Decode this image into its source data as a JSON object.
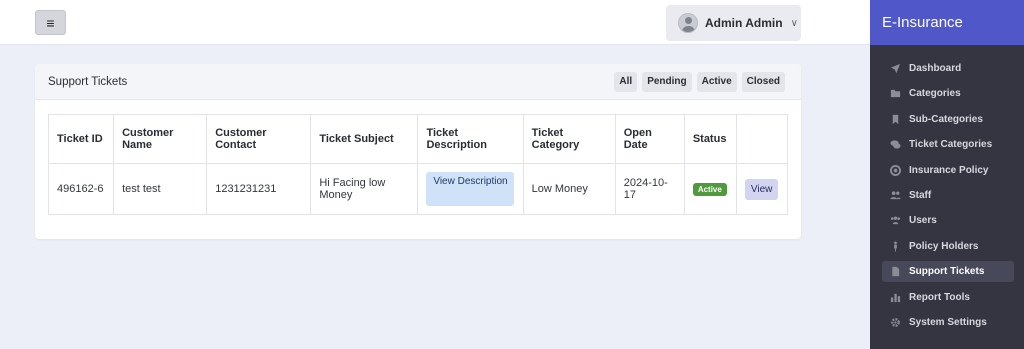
{
  "topbar": {
    "menu_icon": "≡",
    "user_name": "Admin Admin",
    "chevron": "∨"
  },
  "sidebar": {
    "brand": "E-Insurance",
    "items": [
      {
        "label": "Dashboard",
        "icon": "send-icon"
      },
      {
        "label": "Categories",
        "icon": "folder-icon"
      },
      {
        "label": "Sub-Categories",
        "icon": "bookmark-icon"
      },
      {
        "label": "Ticket Categories",
        "icon": "comments-icon"
      },
      {
        "label": "Insurance Policy",
        "icon": "lifebuoy-icon"
      },
      {
        "label": "Staff",
        "icon": "users-icon"
      },
      {
        "label": "Users",
        "icon": "user-group-icon"
      },
      {
        "label": "Policy Holders",
        "icon": "person-icon"
      },
      {
        "label": "Support Tickets",
        "icon": "file-icon",
        "active": true
      },
      {
        "label": "Report Tools",
        "icon": "bar-chart-icon"
      },
      {
        "label": "System Settings",
        "icon": "gear-icon"
      }
    ]
  },
  "card": {
    "title": "Support Tickets",
    "filters": [
      "All",
      "Pending",
      "Active",
      "Closed"
    ]
  },
  "table": {
    "headers": [
      "Ticket ID",
      "Customer Name",
      "Customer Contact",
      "Ticket Subject",
      "Ticket Description",
      "Ticket Category",
      "Open Date",
      "Status",
      ""
    ],
    "rows": [
      {
        "ticket_id": "496162-6",
        "customer_name": "test test",
        "customer_contact": "1231231231",
        "subject": "Hi Facing low Money",
        "description_button": "View Description",
        "category": "Low Money",
        "open_date": "2024-10-17",
        "status": "Active",
        "action": "View"
      }
    ]
  },
  "colors": {
    "brand": "#5058c9",
    "sidebar": "#343541",
    "status_active": "#4e9a3c"
  }
}
